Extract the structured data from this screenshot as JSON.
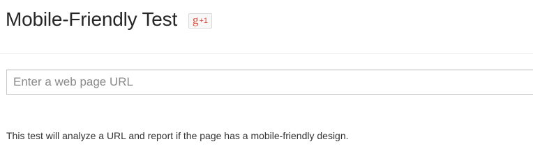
{
  "header": {
    "title": "Mobile-Friendly Test",
    "gplus": {
      "g": "g",
      "plus_one": "+1",
      "icon": "google-plus-one-icon"
    }
  },
  "search": {
    "placeholder": "Enter a web page URL",
    "value": ""
  },
  "main": {
    "description": "This test will analyze a URL and report if the page has a mobile-friendly design."
  },
  "colors": {
    "gplus_red": "#dd4b39",
    "title_text": "#262626",
    "input_border": "#c8c8c8"
  }
}
